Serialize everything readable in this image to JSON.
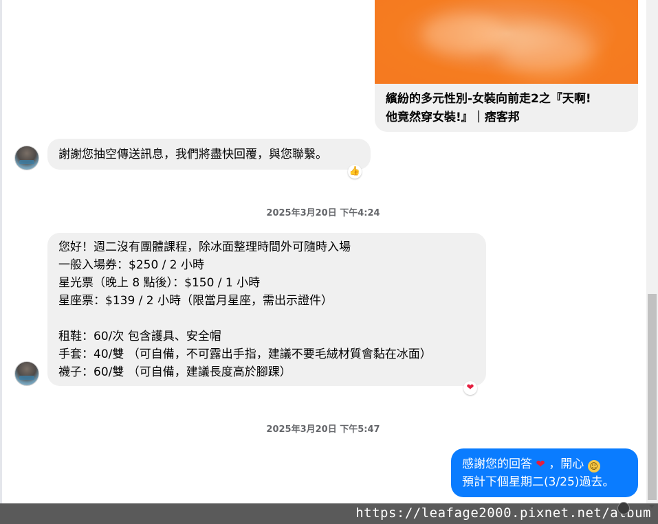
{
  "link_preview": {
    "title_line1": "繽紛的多元性別-女裝向前走2之『天啊!",
    "title_line2": "他竟然穿女裝!』｜痞客邦"
  },
  "messages": {
    "auto_reply": "謝謝您抽空傳送訊息，我們將盡快回覆，與您聯繫。",
    "auto_reply_reaction": "thumbs-up",
    "timestamp1": "2025年3月20日 下午4:24",
    "info_lines": [
      "您好！週二沒有團體課程，除冰面整理時間外可隨時入場",
      "一般入場券：$250 / 2 小時",
      "星光票（晚上 8 點後）：$150 / 1 小時",
      "星座票：$139 / 2 小時（限當月星座，需出示證件）",
      "",
      "租鞋：60/次 包含護具、安全帽",
      "手套：40/雙 （可自備，不可露出手指，建議不要毛絨材質會黏在冰面）",
      "襪子：60/雙 （可自備，建議長度高於腳踝）"
    ],
    "info_reaction": "heart",
    "timestamp2": "2025年3月20日 下午5:47",
    "reply_part1": "感謝您的回答",
    "reply_heart": "❤",
    "reply_part2": "，開心",
    "reply_smile": "☺",
    "reply_line2": "預計下個星期二(3/25)過去。"
  },
  "footer": {
    "url": "https://leafage2000.pixnet.net/album"
  },
  "colors": {
    "outgoing_bubble": "#0a7cff",
    "incoming_bubble": "#f0f0f0",
    "link_thumb": "#f57920"
  }
}
